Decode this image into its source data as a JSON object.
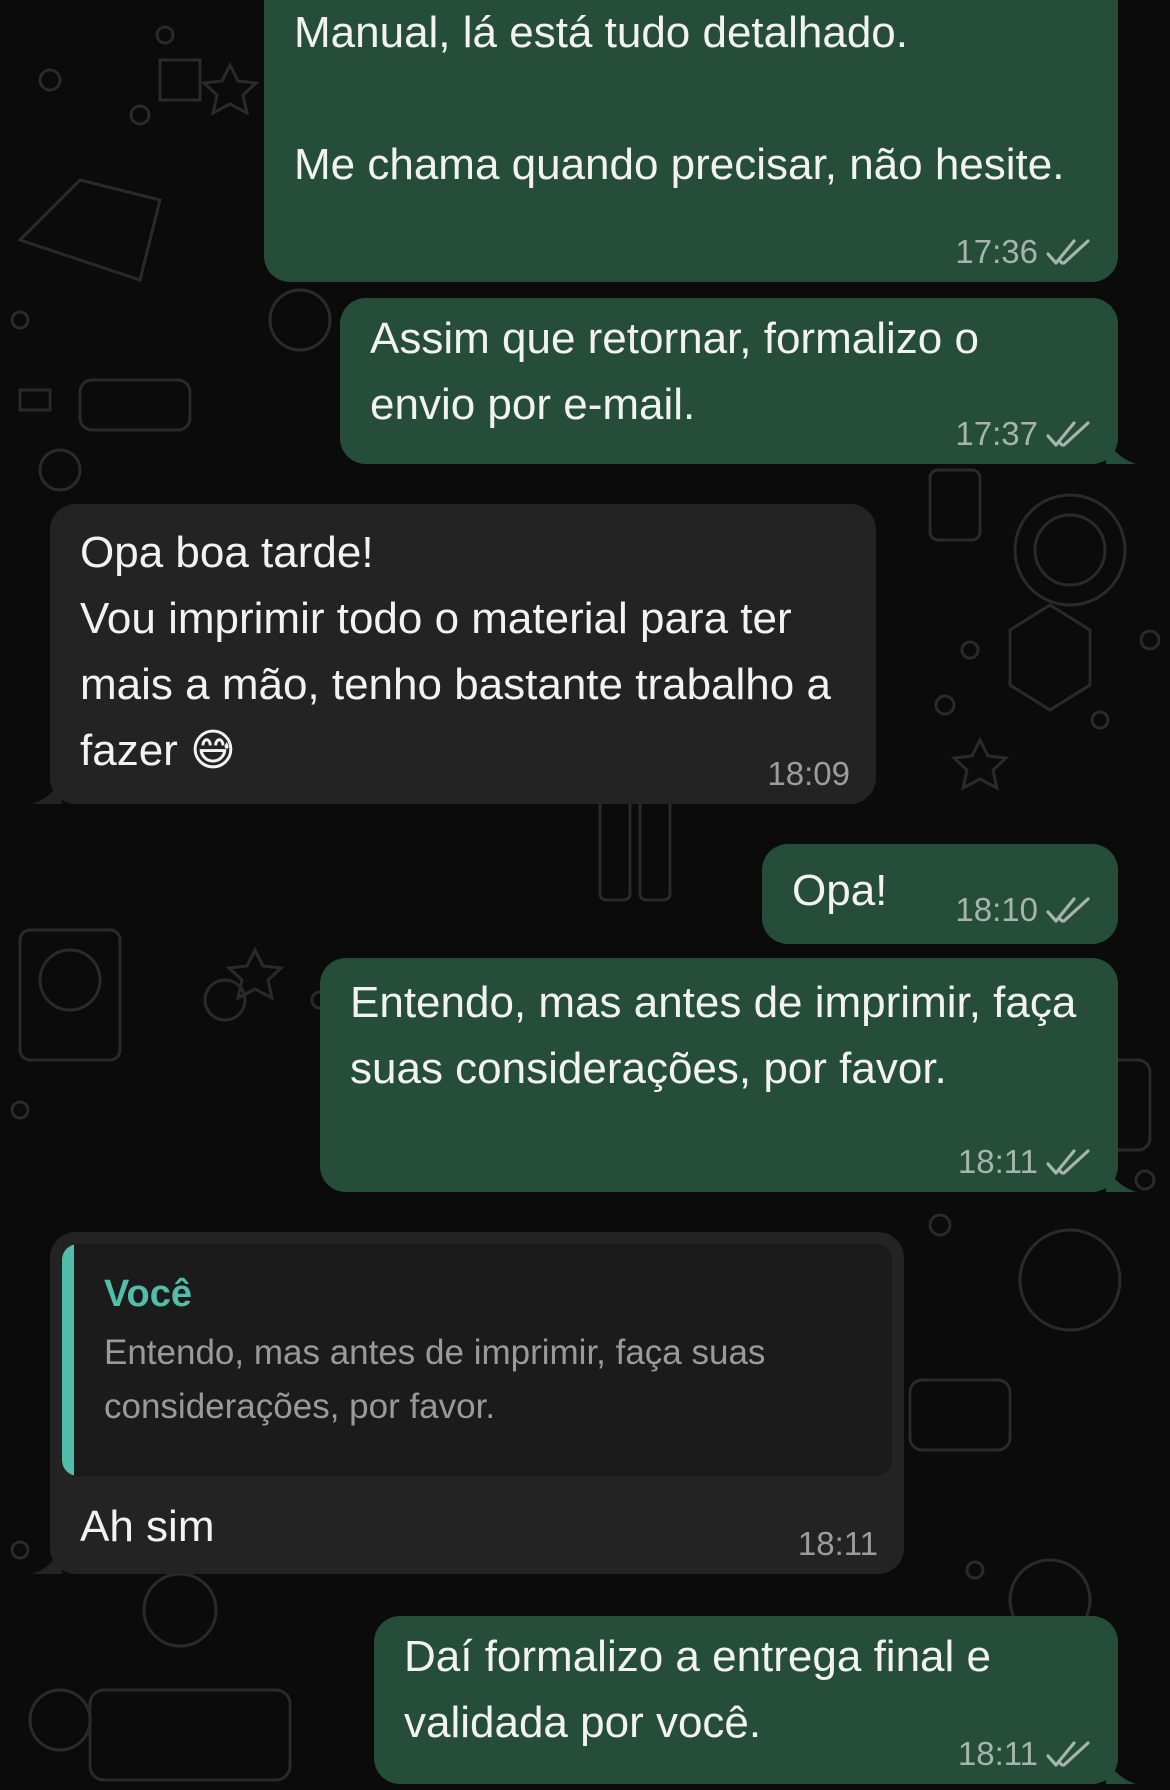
{
  "theme": {
    "outgoing_bubble": "#254d3a",
    "incoming_bubble": "#232323",
    "quote_accent": "#53bdab",
    "read_ticks": "#a6b5ac",
    "background": "#0b0b0b"
  },
  "messages": [
    {
      "direction": "out",
      "text": "Manual, lá está tudo detalhado.\n\nMe chama quando precisar, não hesite.",
      "time": "17:36",
      "status": "read"
    },
    {
      "direction": "out",
      "text": "Assim que retornar, formalizo o envio por e-mail.",
      "time": "17:37",
      "status": "read"
    },
    {
      "direction": "in",
      "text": "Opa boa tarde!\nVou imprimir todo o material para ter mais a mão, tenho bastante trabalho a fazer 😅",
      "time": "18:09"
    },
    {
      "direction": "out",
      "text": "Opa!",
      "time": "18:10",
      "status": "read"
    },
    {
      "direction": "out",
      "text": "Entendo, mas antes de imprimir, faça suas considerações, por favor.",
      "time": "18:11",
      "status": "read"
    },
    {
      "direction": "in",
      "text": "Ah sim",
      "time": "18:11",
      "reply_to": {
        "author": "Você",
        "text": "Entendo, mas antes de imprimir, faça suas considerações, por favor."
      }
    },
    {
      "direction": "out",
      "text": "Daí formalizo a entrega final e validada por você.",
      "time": "18:11",
      "status": "read"
    }
  ]
}
